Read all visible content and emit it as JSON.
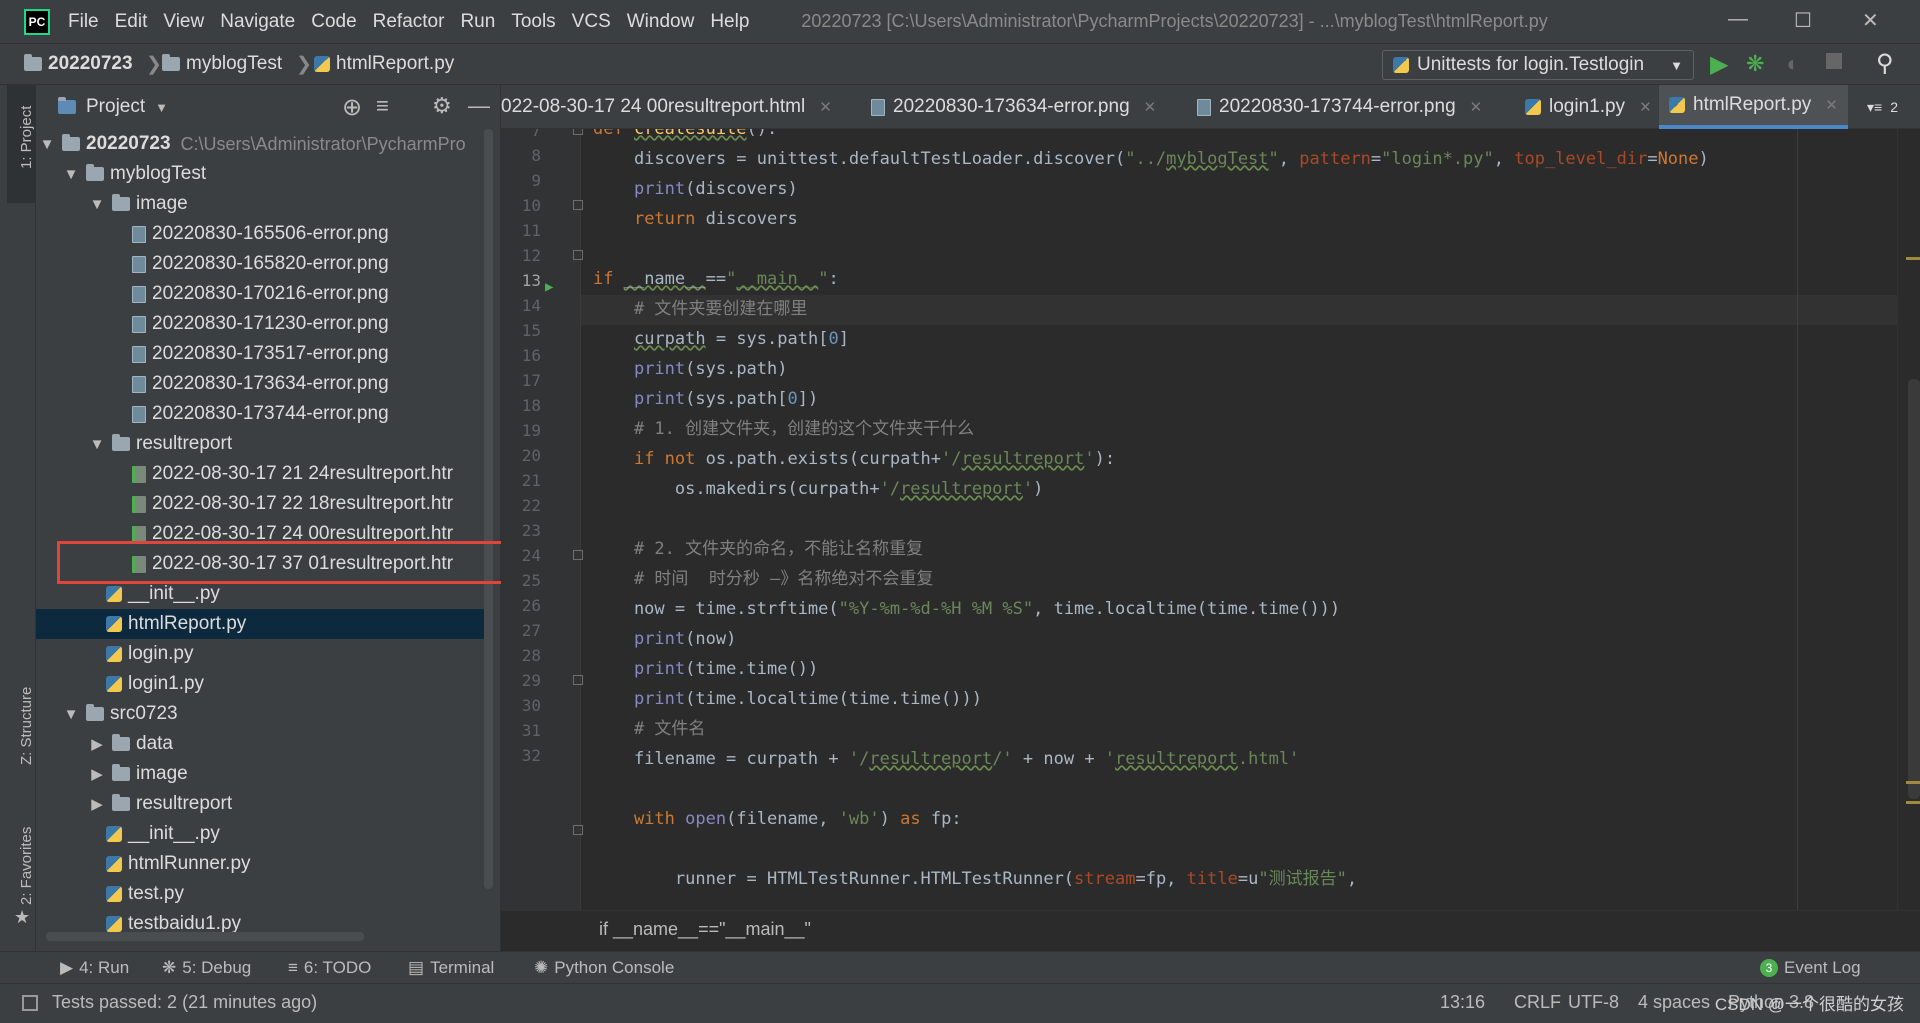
{
  "menubar": {
    "logo": "PC",
    "items": [
      "File",
      "Edit",
      "View",
      "Navigate",
      "Code",
      "Refactor",
      "Run",
      "Tools",
      "VCS",
      "Window",
      "Help"
    ],
    "window_title": "20220723 [C:\\Users\\Administrator\\PycharmProjects\\20220723] - ...\\myblogTest\\htmlReport.py"
  },
  "navbar": {
    "crumbs": [
      "20220723",
      "myblogTest",
      "htmlReport.py"
    ],
    "run_config": "Unittests for login.Testlogin"
  },
  "left_strip": {
    "project": "1: Project",
    "structure": "Z: Structure",
    "favorites": "2: Favorites"
  },
  "project_panel": {
    "title": "Project",
    "tree": [
      {
        "label": "20220723",
        "path": "C:\\Users\\Administrator\\PycharmPro",
        "icon": "folder-icon",
        "arrow": "▼"
      },
      {
        "label": "myblogTest",
        "icon": "folder-icon",
        "arrow": "▼"
      },
      {
        "label": "image",
        "icon": "folder-icon",
        "arrow": "▼"
      },
      {
        "label": "20220830-165506-error.png",
        "icon": "image-file-icon"
      },
      {
        "label": "20220830-165820-error.png",
        "icon": "image-file-icon"
      },
      {
        "label": "20220830-170216-error.png",
        "icon": "image-file-icon"
      },
      {
        "label": "20220830-171230-error.png",
        "icon": "image-file-icon"
      },
      {
        "label": "20220830-173517-error.png",
        "icon": "image-file-icon"
      },
      {
        "label": "20220830-173634-error.png",
        "icon": "image-file-icon"
      },
      {
        "label": "20220830-173744-error.png",
        "icon": "image-file-icon"
      },
      {
        "label": "resultreport",
        "icon": "folder-icon",
        "arrow": "▼"
      },
      {
        "label": "2022-08-30-17 21 24resultreport.htr",
        "icon": "html-file-icon"
      },
      {
        "label": "2022-08-30-17 22 18resultreport.htr",
        "icon": "html-file-icon"
      },
      {
        "label": "2022-08-30-17 24 00resultreport.htr",
        "icon": "html-file-icon"
      },
      {
        "label": "2022-08-30-17 37 01resultreport.htr",
        "icon": "html-file-icon"
      },
      {
        "label": "__init__.py",
        "icon": "python-file-icon"
      },
      {
        "label": "htmlReport.py",
        "icon": "python-file-icon"
      },
      {
        "label": "login.py",
        "icon": "python-file-icon"
      },
      {
        "label": "login1.py",
        "icon": "python-file-icon"
      },
      {
        "label": "src0723",
        "icon": "folder-icon",
        "arrow": "▼"
      },
      {
        "label": "data",
        "icon": "folder-icon",
        "arrow": "▶"
      },
      {
        "label": "image",
        "icon": "folder-icon",
        "arrow": "▶"
      },
      {
        "label": "resultreport",
        "icon": "folder-icon",
        "arrow": "▶"
      },
      {
        "label": "__init__.py",
        "icon": "python-file-icon"
      },
      {
        "label": "htmlRunner.py",
        "icon": "python-file-icon"
      },
      {
        "label": "test.py",
        "icon": "python-file-icon"
      },
      {
        "label": "testbaidu1.py",
        "icon": "python-file-icon"
      }
    ]
  },
  "tabs": [
    {
      "label": "022-08-30-17 24 00resultreport.html",
      "icon": "html-file-icon"
    },
    {
      "label": "20220830-173634-error.png",
      "icon": "image-file-icon"
    },
    {
      "label": "20220830-173744-error.png",
      "icon": "image-file-icon"
    },
    {
      "label": "login1.py",
      "icon": "python-file-icon"
    },
    {
      "label": "htmlReport.py",
      "icon": "python-file-icon",
      "active": true
    }
  ],
  "tab_overflow": "2",
  "editor": {
    "line_numbers": [
      "7",
      "8",
      "9",
      "10",
      "11",
      "12",
      "13",
      "14",
      "15",
      "16",
      "17",
      "18",
      "19",
      "20",
      "21",
      "22",
      "23",
      "24",
      "25",
      "26",
      "27",
      "28",
      "29",
      "30",
      "31",
      "32"
    ],
    "current_line": "13",
    "breadcrumb": "if __name__==\"__main__\""
  },
  "bottom_tools": {
    "run": "4: Run",
    "debug": "5: Debug",
    "todo": "6: TODO",
    "terminal": "Terminal",
    "python_console": "Python Console",
    "event_log_count": "3",
    "event_log": "Event Log"
  },
  "status": {
    "message": "Tests passed: 2 (21 minutes ago)",
    "position": "13:16",
    "line_sep": "CRLF",
    "encoding": "UTF-8",
    "indent": "4 spaces",
    "interpreter": "Python 3.8"
  },
  "watermark": "CSDN @一个很酷的女孩"
}
